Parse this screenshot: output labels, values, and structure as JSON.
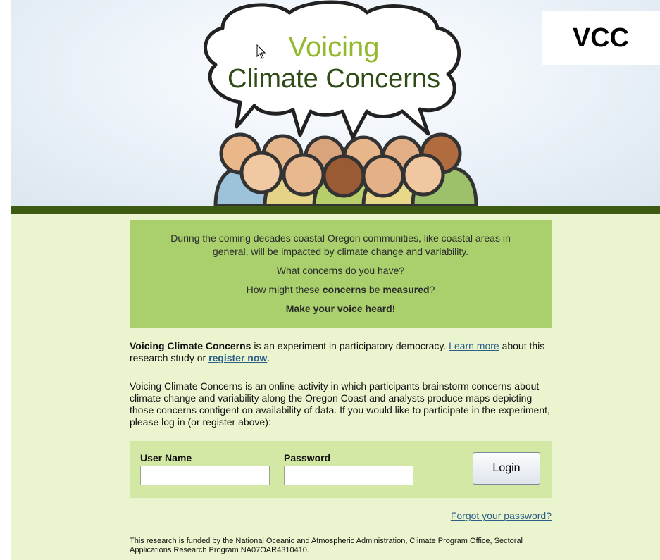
{
  "header": {
    "logo_line1": "Voicing",
    "logo_line2": "Climate Concerns",
    "badge": "VCC"
  },
  "intro": {
    "line1": "During the coming decades coastal Oregon communities, like coastal areas in",
    "line2": "general, will be impacted by climate change and variability.",
    "q1": "What concerns do you have?",
    "q2_pre": "How might these ",
    "q2_b1": "concerns",
    "q2_mid": " be ",
    "q2_b2": "measured",
    "q2_post": "?",
    "cta": "Make your voice heard!"
  },
  "about": {
    "bold": "Voicing Climate Concerns",
    "text1": " is an experiment in participatory democracy. ",
    "learn_more": "Learn more",
    "text2": " about this research study or ",
    "register": "register now",
    "text3": "."
  },
  "description": "Voicing Climate Concerns is an online activity in which participants brainstorm concerns about climate change and variability along the Oregon Coast and analysts produce maps depicting those concerns contigent on availability of data. If you would like to participate in the experiment, please log in (or register above):",
  "login": {
    "username_label": "User Name",
    "username_value": "",
    "password_label": "Password",
    "password_value": "",
    "button": "Login"
  },
  "forgot": "Forgot your password?",
  "funding": "This research is funded by the National Oceanic and Atmospheric Administration, Climate Program Office, Sectoral Applications Research Program NA07OAR4310410."
}
